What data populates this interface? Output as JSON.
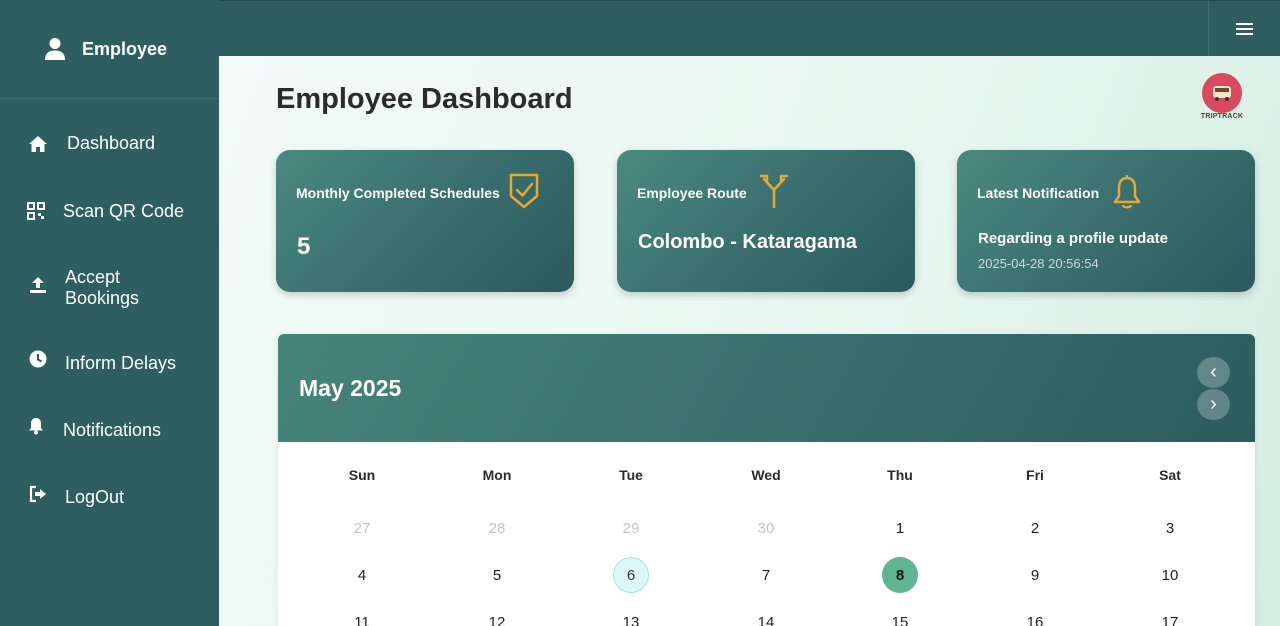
{
  "sidebar": {
    "title": "Employee",
    "items": [
      {
        "label": "Dashboard",
        "icon": "home-icon"
      },
      {
        "label": "Scan QR Code",
        "icon": "qr-code-icon"
      },
      {
        "label": "Accept\nBookings",
        "icon": "upload-icon"
      },
      {
        "label": "Inform Delays",
        "icon": "clock-icon"
      },
      {
        "label": "Notifications",
        "icon": "bell-icon"
      },
      {
        "label": "LogOut",
        "icon": "logout-icon"
      }
    ]
  },
  "topbar": {
    "menu_icon": "hamburger-icon"
  },
  "main": {
    "title": "Employee Dashboard",
    "logo_text": "TRIPTRACK"
  },
  "cards": {
    "schedules": {
      "title": "Monthly Completed Schedules",
      "value": "5",
      "icon": "shield-check-icon"
    },
    "route": {
      "title": "Employee Route",
      "value": "Colombo - Kataragama",
      "icon": "route-split-icon"
    },
    "notification": {
      "title": "Latest Notification",
      "message": "Regarding a profile update",
      "time": "2025-04-28 20:56:54",
      "icon": "bell-icon"
    }
  },
  "calendar": {
    "month": "May 2025",
    "prev": "‹",
    "next": "›",
    "weekdays": [
      "Sun",
      "Mon",
      "Tue",
      "Wed",
      "Thu",
      "Fri",
      "Sat"
    ],
    "weeks": [
      [
        "27",
        "28",
        "29",
        "30",
        "1",
        "2",
        "3"
      ],
      [
        "4",
        "5",
        "6",
        "7",
        "8",
        "9",
        "10"
      ],
      [
        "11",
        "12",
        "13",
        "14",
        "15",
        "16",
        "17"
      ]
    ],
    "muted_days": [
      "27",
      "28",
      "29",
      "30"
    ],
    "today": "6",
    "selected": "8"
  },
  "colors": {
    "sidebar": "#2f5e61",
    "accent": "#e5a935",
    "selected_day": "#5fb58e",
    "today_day": "#dff6f6"
  }
}
